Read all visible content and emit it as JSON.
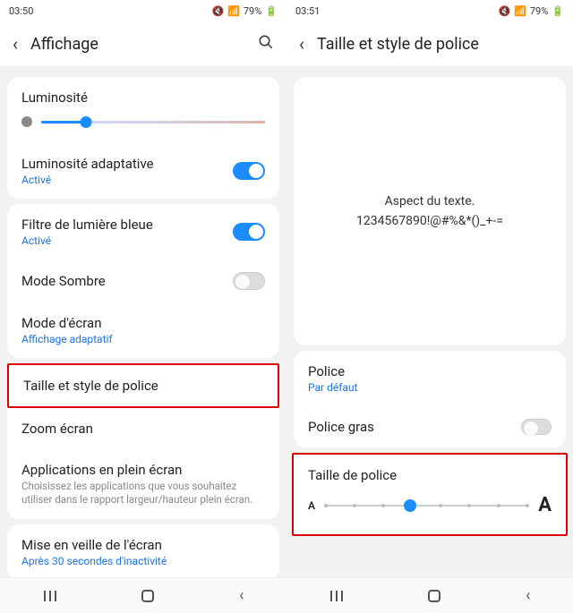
{
  "left": {
    "status": {
      "time": "03:50",
      "battery": "79%"
    },
    "header": {
      "title": "Affichage"
    },
    "brightness": {
      "label": "Luminosité"
    },
    "adaptive": {
      "label": "Luminosité adaptative",
      "sub": "Activé"
    },
    "bluelight": {
      "label": "Filtre de lumière bleue",
      "sub": "Activé"
    },
    "darkmode": {
      "label": "Mode Sombre"
    },
    "screenmode": {
      "label": "Mode d'écran",
      "sub": "Affichage adaptatif"
    },
    "fontstyle": {
      "label": "Taille et style de police"
    },
    "zoom": {
      "label": "Zoom écran"
    },
    "fullscreen": {
      "label": "Applications en plein écran",
      "sub": "Choisissez les applications que vous souhaitez utiliser dans le rapport largeur/hauteur plein écran."
    },
    "sleep": {
      "label": "Mise en veille de l'écran",
      "sub": "Après 30 secondes d'inactivité"
    }
  },
  "right": {
    "status": {
      "time": "03:51",
      "battery": "79%"
    },
    "header": {
      "title": "Taille et style de police"
    },
    "preview": {
      "line1": "Aspect du texte.",
      "line2": "1234567890!@#%&*()_+-="
    },
    "font": {
      "label": "Police",
      "sub": "Par défaut"
    },
    "bold": {
      "label": "Police gras"
    },
    "fontsize": {
      "label": "Taille de police"
    }
  }
}
